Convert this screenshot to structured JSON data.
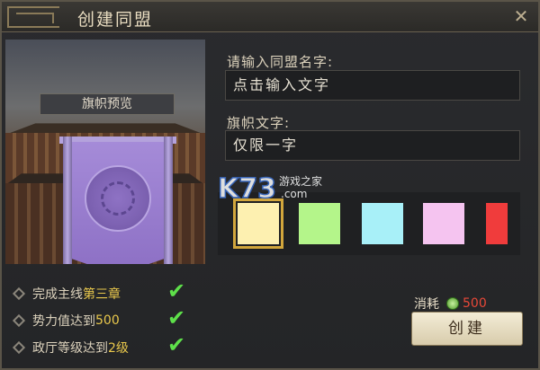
{
  "dialog": {
    "title": "创建同盟",
    "close_icon": "close-icon"
  },
  "preview": {
    "label": "旗帜预览",
    "banner_color": "#9b80d0"
  },
  "form": {
    "name_label": "请输入同盟名字:",
    "name_placeholder": "点击输入文字",
    "banner_text_label": "旗帜文字:",
    "banner_text_placeholder": "仅限一字"
  },
  "colors": [
    {
      "name": "light-yellow",
      "hex": "#fdf0b0",
      "selected": true
    },
    {
      "name": "light-green",
      "hex": "#b4f58a",
      "selected": false
    },
    {
      "name": "light-cyan",
      "hex": "#a8f0f8",
      "selected": false
    },
    {
      "name": "light-pink",
      "hex": "#f5c4f0",
      "selected": false
    },
    {
      "name": "red",
      "hex": "#f03c3c",
      "selected": false
    }
  ],
  "requirements": [
    {
      "text": "完成主线",
      "highlight": "第三章",
      "met": true
    },
    {
      "text": "势力值达到",
      "highlight": "500",
      "met": true
    },
    {
      "text": "政厅等级达到",
      "highlight": "2级",
      "met": true
    }
  ],
  "cost": {
    "label": "消耗",
    "value": "500",
    "icon": "coin-icon"
  },
  "create_button": "创建",
  "watermark": {
    "brand": "K73",
    "tagline": "游戏之家",
    "domain": ".com"
  }
}
